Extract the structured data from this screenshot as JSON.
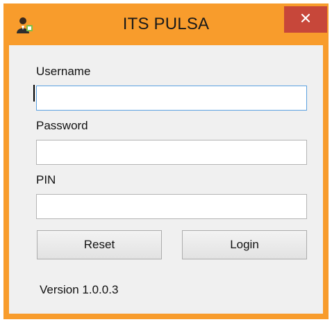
{
  "window": {
    "title": "ITS PULSA",
    "app_icon": "user-icon",
    "close_icon": "close-icon",
    "frame_color": "#f89c2c",
    "close_color": "#c7473a"
  },
  "form": {
    "username_label": "Username",
    "username_value": "",
    "password_label": "Password",
    "password_value": "",
    "pin_label": "PIN",
    "pin_value": ""
  },
  "buttons": {
    "reset_label": "Reset",
    "login_label": "Login"
  },
  "footer": {
    "version": "Version 1.0.0.3"
  }
}
